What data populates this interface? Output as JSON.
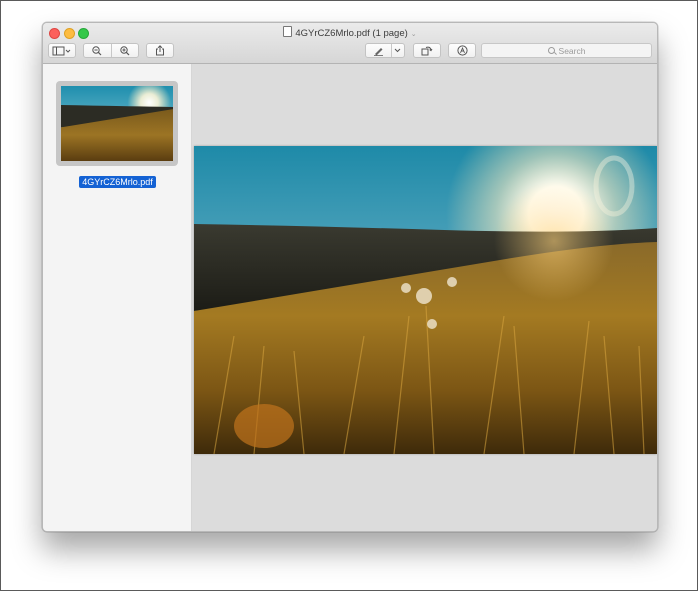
{
  "window": {
    "title": "4GYrCZ6Mrlo.pdf (1 page)"
  },
  "toolbar": {
    "buttons": [
      {
        "name": "sidebar-toggle",
        "icon": "sidebar-icon"
      },
      {
        "name": "zoom-out",
        "icon": "zoom-out-icon"
      },
      {
        "name": "zoom-in",
        "icon": "zoom-in-icon"
      },
      {
        "name": "share",
        "icon": "share-icon"
      },
      {
        "name": "markup",
        "icon": "pen-icon"
      },
      {
        "name": "rotate",
        "icon": "rotate-icon"
      },
      {
        "name": "annotate",
        "icon": "annotate-icon"
      }
    ],
    "search_placeholder": "Search"
  },
  "sidebar": {
    "thumbnail_label": "4GYrCZ6Mrlo.pdf"
  },
  "colors": {
    "selection": "#1462d4",
    "close": "#fc605c",
    "minimize": "#fdbc40",
    "maximize": "#34c84a"
  }
}
